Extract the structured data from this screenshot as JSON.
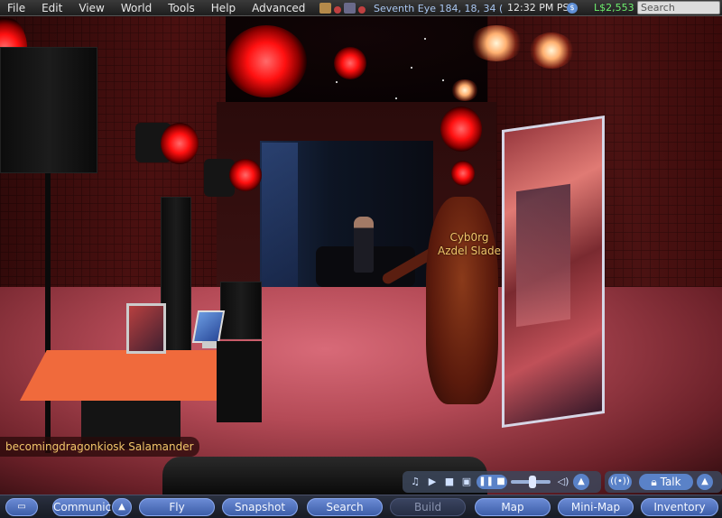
{
  "menu": {
    "items": [
      "File",
      "Edit",
      "View",
      "World",
      "Tools",
      "Help",
      "Advanced"
    ]
  },
  "status": {
    "location": "Seventh Eye 184, 18, 34 (",
    "time": "12:32 PM PST",
    "balance": "L$2,553",
    "search_placeholder": "Search"
  },
  "scene": {
    "nametag_avatar_line1": "Cyb0rg",
    "nametag_avatar_line2": "Azdel Slade",
    "nametag_local": "becomingdragonkiosk Salamander"
  },
  "media_bar": {
    "icons": [
      "music-icon",
      "play-icon",
      "stop-icon",
      "media-icon",
      "pause-icon",
      "volume-slider",
      "speaker-icon",
      "chevron-up-icon"
    ]
  },
  "talk": {
    "label": "Talk"
  },
  "toolbar": {
    "communicate": "Communic",
    "fly": "Fly",
    "snapshot": "Snapshot",
    "search": "Search",
    "build": "Build",
    "map": "Map",
    "minimap": "Mini-Map",
    "inventory": "Inventory"
  },
  "colors": {
    "menubar": "#2a2a2a",
    "location_text": "#a9c6f0",
    "balance_text": "#6ef06e",
    "toolbar_button": "#4f70bf",
    "nametag": "#f2c66a"
  }
}
